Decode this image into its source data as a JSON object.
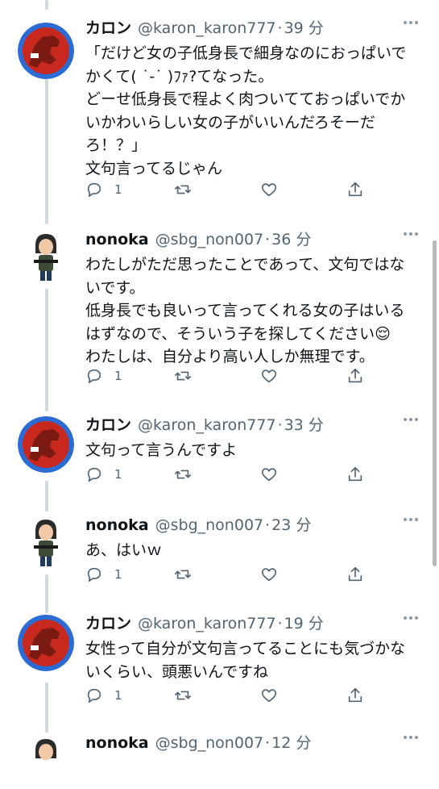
{
  "tweets": [
    {
      "name": "カロン",
      "handle": "@karon_karon777",
      "sep": "·",
      "time": "39 分",
      "lines": [
        "「だけど女の子低身長で細身なのにおっぱいで",
        "かくて( ˙-˙ )ﾌｧ?てなった。",
        "どーせ低身長で程よく肉ついてておっぱいでか",
        "いかわいらしい女の子がいいんだろそーだ",
        "ろ！？」",
        "文句言ってるじゃん"
      ],
      "reply_count": "1"
    },
    {
      "name": "nonoka",
      "handle": "@sbg_non007",
      "sep": "·",
      "time": "36 分",
      "lines": [
        "わたしがただ思ったことであって、文句ではな",
        "いです。",
        "低身長でも良いって言ってくれる女の子はいる",
        "はずなので、そういう子を探してください😌",
        "わたしは、自分より高い人しか無理です。"
      ],
      "reply_count": "1"
    },
    {
      "name": "カロン",
      "handle": "@karon_karon777",
      "sep": "·",
      "time": "33 分",
      "lines": [
        "文句って言うんですよ"
      ],
      "reply_count": "1"
    },
    {
      "name": "nonoka",
      "handle": "@sbg_non007",
      "sep": "·",
      "time": "23 分",
      "lines": [
        "あ、はいｗ"
      ],
      "reply_count": "1"
    },
    {
      "name": "カロン",
      "handle": "@karon_karon777",
      "sep": "·",
      "time": "19 分",
      "lines": [
        "女性って自分が文句言ってることにも気づかな",
        "いくらい、頭悪いんですね"
      ],
      "reply_count": "1"
    },
    {
      "name": "nonoka",
      "handle": "@sbg_non007",
      "sep": "·",
      "time": "12 分",
      "lines": [],
      "reply_count": ""
    }
  ],
  "icons": {
    "reply": "reply-icon",
    "retweet": "retweet-icon",
    "like": "like-icon",
    "share": "share-icon",
    "more": "more-icon"
  },
  "colors": {
    "text": "#0f1419",
    "muted": "#536471",
    "icon": "#536471",
    "thread_line": "#cfd9de"
  }
}
